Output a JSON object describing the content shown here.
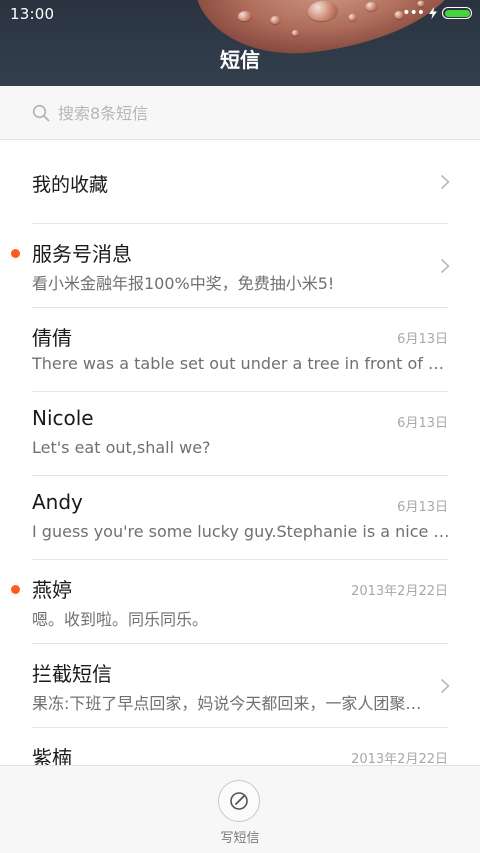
{
  "status_bar": {
    "time": "13:00",
    "signal_dots": "•••",
    "battery_color": "#46d13f",
    "battery_level": 1.0
  },
  "header": {
    "title": "短信"
  },
  "search": {
    "placeholder": "搜索8条短信",
    "value": ""
  },
  "list": {
    "favorites": {
      "label": "我的收藏"
    },
    "conversations": [
      {
        "name": "服务号消息",
        "preview": "看小米金融年报100%中奖，免费抽小米5!",
        "date": "",
        "unread": true,
        "chevron": true
      },
      {
        "name": "倩倩",
        "preview": "There was a table set out under a tree in front of the ho…",
        "date": "6月13日",
        "unread": false,
        "chevron": false
      },
      {
        "name": "Nicole",
        "preview": "Let's eat out,shall we?",
        "date": "6月13日",
        "unread": false,
        "chevron": false
      },
      {
        "name": "Andy",
        "preview": "I guess you're some lucky guy.Stephanie is a nice girl.",
        "date": "6月13日",
        "unread": false,
        "chevron": false
      },
      {
        "name": "燕婷",
        "preview": "嗯。收到啦。同乐同乐。",
        "date": "2013年2月22日",
        "unread": true,
        "chevron": false
      },
      {
        "name": "拦截短信",
        "preview": "果冻:下班了早点回家，妈说今天都回来，一家人团聚过…",
        "date": "",
        "unread": false,
        "chevron": true
      },
      {
        "name": "紫楠",
        "preview": "",
        "date": "2013年2月22日",
        "unread": false,
        "chevron": false
      }
    ]
  },
  "bottom_bar": {
    "compose_label": "写短信",
    "compose_icon": "pencil-circle-icon"
  },
  "colors": {
    "unread_dot": "#ff5b1a",
    "header_bg": "#2f3a48"
  }
}
